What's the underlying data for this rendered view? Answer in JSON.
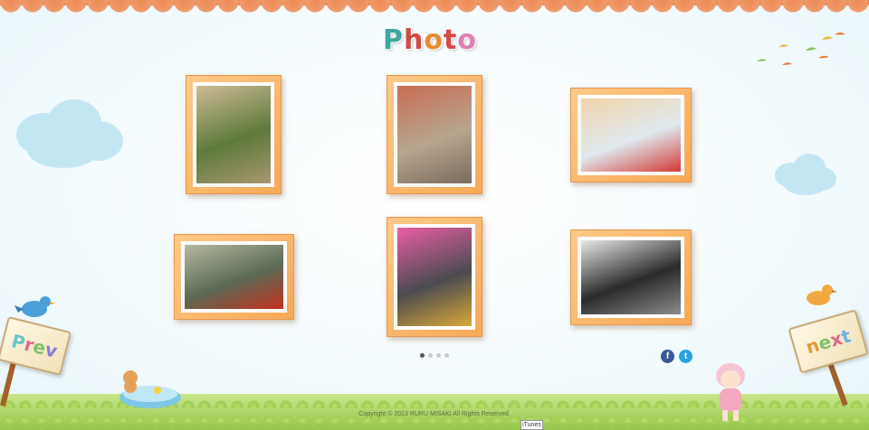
{
  "title": {
    "letters": [
      "P",
      "h",
      "o",
      "t",
      "o"
    ],
    "colors": [
      "#3fa6a0",
      "#d04a45",
      "#e88a2e",
      "#d44a4a",
      "#e07fb3"
    ]
  },
  "gallery": {
    "photos": [
      {
        "name": "photo-dinosaur-sculpture",
        "colors": [
          "#5e7a3b",
          "#a79770",
          "#cdbb96"
        ]
      },
      {
        "name": "photo-playground-slide",
        "colors": [
          "#b7a58e",
          "#7a6a5c",
          "#c86d53"
        ]
      },
      {
        "name": "photo-toddler-closeup",
        "colors": [
          "#dfe9ef",
          "#d23a36",
          "#f2d3a8"
        ]
      },
      {
        "name": "photo-red-berries",
        "colors": [
          "#5b6a55",
          "#c5321f",
          "#b6b9a0"
        ]
      },
      {
        "name": "photo-toddler-snow-hat",
        "colors": [
          "#4b4b50",
          "#d9a73a",
          "#ea5ea5"
        ]
      },
      {
        "name": "photo-dark-window",
        "colors": [
          "#2b2b2b",
          "#8b8b8b",
          "#e8e8e8"
        ]
      }
    ],
    "pagination": {
      "count": 4,
      "active": 0
    }
  },
  "social": {
    "facebook": "f",
    "twitter": "t"
  },
  "nav": {
    "prev": {
      "letters": [
        "P",
        "r",
        "e",
        "v"
      ],
      "colors": [
        "#6bc4c6",
        "#e06a8c",
        "#7fc06a",
        "#8a7fd6"
      ]
    },
    "next": {
      "letters": [
        "n",
        "e",
        "x",
        "t"
      ],
      "colors": [
        "#e39a3a",
        "#7fc06a",
        "#e06a8c",
        "#6bb2e0"
      ]
    }
  },
  "footer": {
    "copyright": "Copyright © 2013 RURU MISAKI All Rights Reserved.",
    "itunes": "iTunes"
  }
}
